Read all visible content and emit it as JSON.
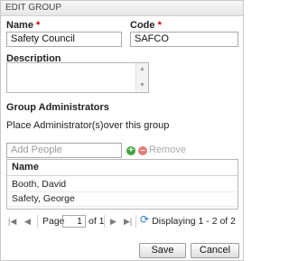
{
  "dialog": {
    "title": "EDIT GROUP"
  },
  "name": {
    "label": "Name",
    "required_mark": "*",
    "value": "Safety Council"
  },
  "code": {
    "label": "Code",
    "required_mark": "*",
    "value": "SAFCO"
  },
  "description": {
    "label": "Description",
    "value": ""
  },
  "administrators": {
    "heading": "Group Administrators",
    "instruction": "Place Administrator(s)over this group",
    "add_placeholder": "Add People",
    "remove_label": "Remove",
    "grid": {
      "column_header": "Name",
      "rows": [
        {
          "name": "Booth, David"
        },
        {
          "name": "Safety, George"
        }
      ]
    },
    "pager": {
      "page_label": "Page",
      "current_page": "1",
      "of_label": "of 1",
      "display_text": "Displaying 1 - 2 of 2"
    }
  },
  "footer": {
    "save_label": "Save",
    "cancel_label": "Cancel"
  },
  "icons": {
    "first": "first-page-icon",
    "prev": "previous-page-icon",
    "next": "next-page-icon",
    "last": "last-page-icon",
    "refresh": "refresh-icon",
    "add": "add-person-icon",
    "remove": "remove-person-icon"
  },
  "colors": {
    "required": "#cc0000",
    "add": "#3fa63f",
    "remove": "#e37b7b",
    "refresh": "#2a7bd1"
  }
}
